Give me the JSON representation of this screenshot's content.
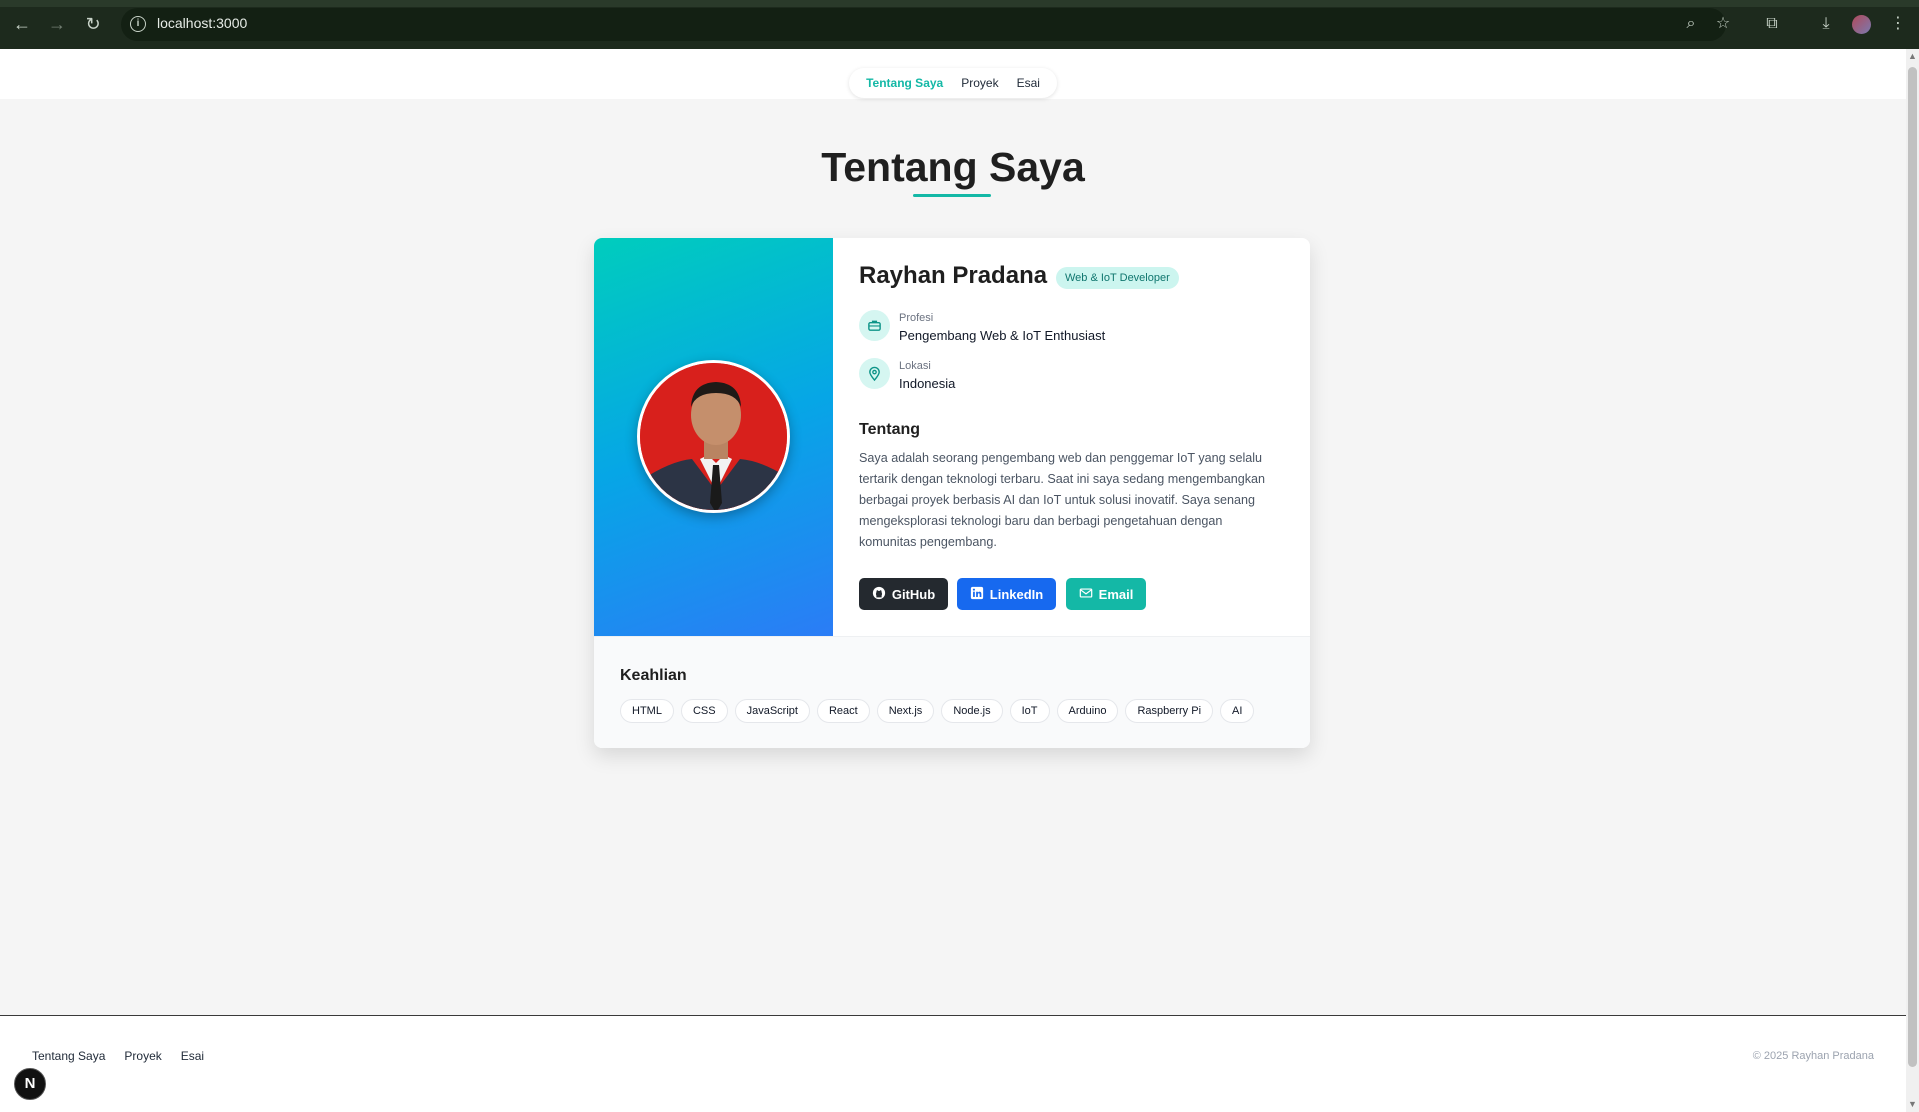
{
  "browser": {
    "url": "localhost:3000"
  },
  "nav": {
    "items": [
      {
        "label": "Tentang Saya",
        "active": true
      },
      {
        "label": "Proyek",
        "active": false
      },
      {
        "label": "Esai",
        "active": false
      }
    ]
  },
  "page": {
    "title": "Tentang Saya"
  },
  "profile": {
    "name": "Rayhan Pradana",
    "role_badge": "Web & IoT Developer",
    "profession_label": "Profesi",
    "profession_value": "Pengembang Web & IoT Enthusiast",
    "location_label": "Lokasi",
    "location_value": "Indonesia",
    "about_heading": "Tentang",
    "about_text": "Saya adalah seorang pengembang web dan penggemar IoT yang selalu tertarik dengan teknologi terbaru. Saat ini saya sedang mengembangkan berbagai proyek berbasis AI dan IoT untuk solusi inovatif. Saya senang mengeksplorasi teknologi baru dan berbagi pengetahuan dengan komunitas pengembang.",
    "buttons": {
      "github": "GitHub",
      "linkedin": "LinkedIn",
      "email": "Email"
    }
  },
  "skills": {
    "heading": "Keahlian",
    "items": [
      "HTML",
      "CSS",
      "JavaScript",
      "React",
      "Next.js",
      "Node.js",
      "IoT",
      "Arduino",
      "Raspberry Pi",
      "AI"
    ]
  },
  "footer": {
    "links": [
      "Tentang Saya",
      "Proyek",
      "Esai"
    ],
    "copyright": "© 2025 Rayhan Pradana"
  },
  "next_badge": "N",
  "colors": {
    "accent": "#14b8a6",
    "linkedin": "#1769ef",
    "github": "#24292f"
  }
}
